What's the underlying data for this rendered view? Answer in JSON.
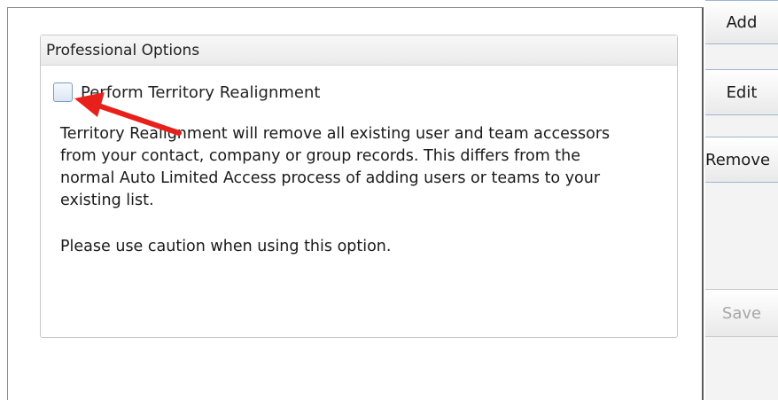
{
  "panel": {
    "group_title": "Professional Options",
    "checkbox_label": "Perform Territory Realignment",
    "checkbox_checked": false,
    "description_lines": [
      "Territory Realignment will remove all existing user and team accessors",
      "from your contact, company or group records.  This differs from the",
      "normal Auto Limited Access process of adding users or teams to your",
      "existing list."
    ],
    "caution_text": "Please use caution when using this option."
  },
  "side_buttons": {
    "add": "Add",
    "edit": "Edit",
    "remove": "Remove",
    "save": "Save"
  },
  "annotation": {
    "arrow_color": "#e8201c"
  }
}
